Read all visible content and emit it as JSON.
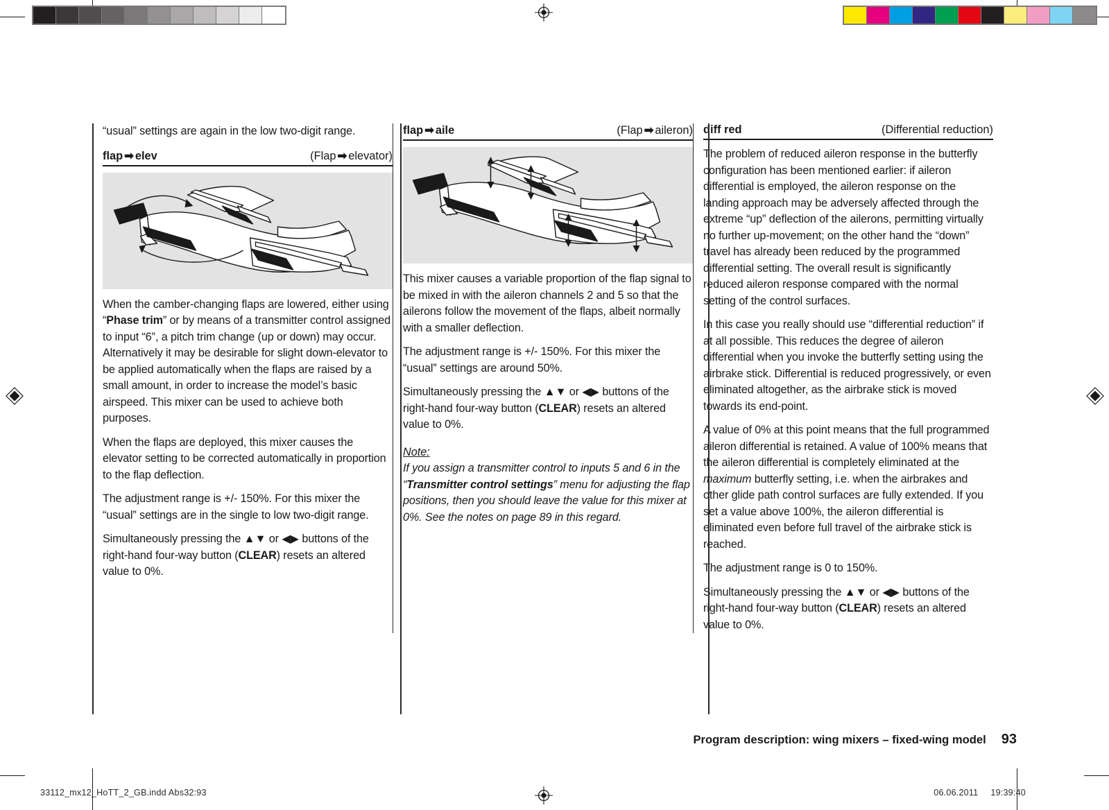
{
  "calibration": {
    "gray_swatches": [
      "#231f20",
      "#3b3739",
      "#504d4e",
      "#656263",
      "#7b7879",
      "#949192",
      "#a9a7a8",
      "#bfbdbe",
      "#d5d3d4",
      "#eeeded",
      "#ffffff"
    ],
    "color_swatches": [
      "#ffe800",
      "#e5007e",
      "#009fe3",
      "#312783",
      "#009e4f",
      "#e30613",
      "#231f20",
      "#faec7d",
      "#f29ec4",
      "#7fd4f4",
      "#8c8a8b"
    ]
  },
  "column1": {
    "lead_text": "“usual” settings are again in the low two-digit range.",
    "heading": {
      "name": "flap",
      "arrow": "➡",
      "target": "elev",
      "caption_open": "(Flap",
      "caption_arrow": "➡",
      "caption_target": "elevator)"
    },
    "figure_name": "flap-to-elevator-diagram",
    "paragraphs": [
      "When the camber-changing flaps are lowered, either using “Phase trim” or by means of a transmitter control assigned to input “6”, a pitch trim change (up or down) may occur. Alternatively it may be desirable for slight down-elevator to be applied automatically when the flaps are raised by a small amount, in order to increase the model’s basic airspeed. This mixer can be used to achieve both purposes.",
      "When the flaps are deployed, this mixer causes the elevator setting to be corrected automatically in proportion to the flap deflection.",
      "The adjustment range is +/- 150%. For this mixer the “usual” settings are in the single to low two-digit range.",
      "Simultaneously pressing the ▲▼ or ◀▶ buttons of the right-hand four-way button (CLEAR) resets an altered value to 0%."
    ],
    "bold_run": "Phase trim",
    "clear_label": "CLEAR"
  },
  "column2": {
    "heading": {
      "name": "flap",
      "arrow": "➡",
      "target": "aile",
      "caption_open": "(Flap",
      "caption_arrow": "➡",
      "caption_target": "aileron)"
    },
    "figure_name": "flap-to-aileron-diagram",
    "paragraphs": [
      "This mixer causes a variable proportion of the flap signal to be mixed in with the aileron channels 2 and 5 so that the ailerons follow the movement of the flaps, albeit normally with a smaller deflection.",
      "The adjustment range is +/- 150%. For this mixer the “usual” settings are around 50%.",
      "Simultaneously pressing the ▲▼ or ◀▶ buttons of the right-hand four-way button (CLEAR) resets an altered value to 0%."
    ],
    "clear_label": "CLEAR",
    "note": {
      "label": "Note:",
      "text_before": "If you assign a transmitter control to inputs 5 and 6 in the “",
      "bold": "Transmitter control settings",
      "text_after": "” menu for adjusting the flap positions, then you should leave the value for this mixer at 0%. See the notes on page 89 in this regard."
    }
  },
  "column3": {
    "heading": {
      "name": "diff red",
      "caption": "(Differential reduction)"
    },
    "paragraphs": [
      "The problem of reduced aileron response in the butterfly configuration has been mentioned earlier: if aileron differential is employed, the aileron response on the landing approach may be adversely affected through the extreme “up” deflection of the ailerons, permitting virtually no further up-movement; on the other hand the “down” travel has already been reduced by the programmed differential setting. The overall result is significantly reduced aileron response compared with the normal setting of the control surfaces.",
      "In this case you really should use “differential reduction” if at all possible. This reduces the degree of aileron differential when you invoke the butterfly setting using the airbrake stick. Differential is reduced progressively, or even eliminated altogether, as the airbrake stick is moved towards its end-point.",
      "The adjustment range is 0 to 150%.",
      "Simultaneously pressing the ▲▼ or ◀▶ buttons of the right-hand four-way button (CLEAR) resets an altered value to 0%."
    ],
    "paragraph_with_italic": {
      "before": "A value of 0% at this point means that the full programmed aileron differential is retained. A value of 100% means that the aileron differential is completely eliminated at the ",
      "italic": "maximum",
      "after": " butterfly setting, i.e. when the airbrakes and other glide path control surfaces are fully extended. If you set a value above 100%, the aileron differential is eliminated even before full travel of the airbrake stick is reached."
    },
    "clear_label": "CLEAR"
  },
  "footer": {
    "title": "Program description: wing mixers – fixed-wing model",
    "page_number": "93"
  },
  "imprint": {
    "file": "33112_mx12_HoTT_2_GB.indd   Abs32:93",
    "date": "06.06.2011",
    "time": "19:39:40"
  }
}
